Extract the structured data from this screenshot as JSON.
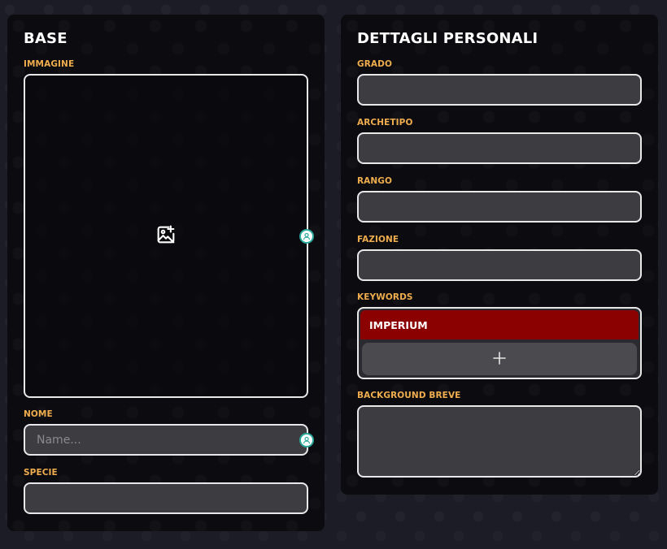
{
  "base": {
    "title": "BASE",
    "image_label": "IMMAGINE",
    "image_icon": "add-image-icon",
    "nome_label": "NOME",
    "nome_placeholder": "Name...",
    "nome_value": "",
    "specie_label": "SPECIE",
    "specie_value": ""
  },
  "dettagli": {
    "title": "DETTAGLI PERSONALI",
    "grado_label": "GRADO",
    "grado_value": "",
    "archetipo_label": "ARCHETIPO",
    "archetipo_value": "",
    "rango_label": "RANGO",
    "rango_value": "",
    "fazione_label": "FAZIONE",
    "fazione_value": "",
    "keywords_label": "KEYWORDS",
    "keywords": [
      "IMPERIUM"
    ],
    "keyword_add_icon": "plus-icon",
    "background_label": "BACKGROUND BREVE",
    "background_value": ""
  },
  "colors": {
    "accent_label": "#f0ad4e",
    "keyword_chip": "#8b0000",
    "panel_bg": "#0b0b10",
    "field_bg": "#3c3c41"
  }
}
